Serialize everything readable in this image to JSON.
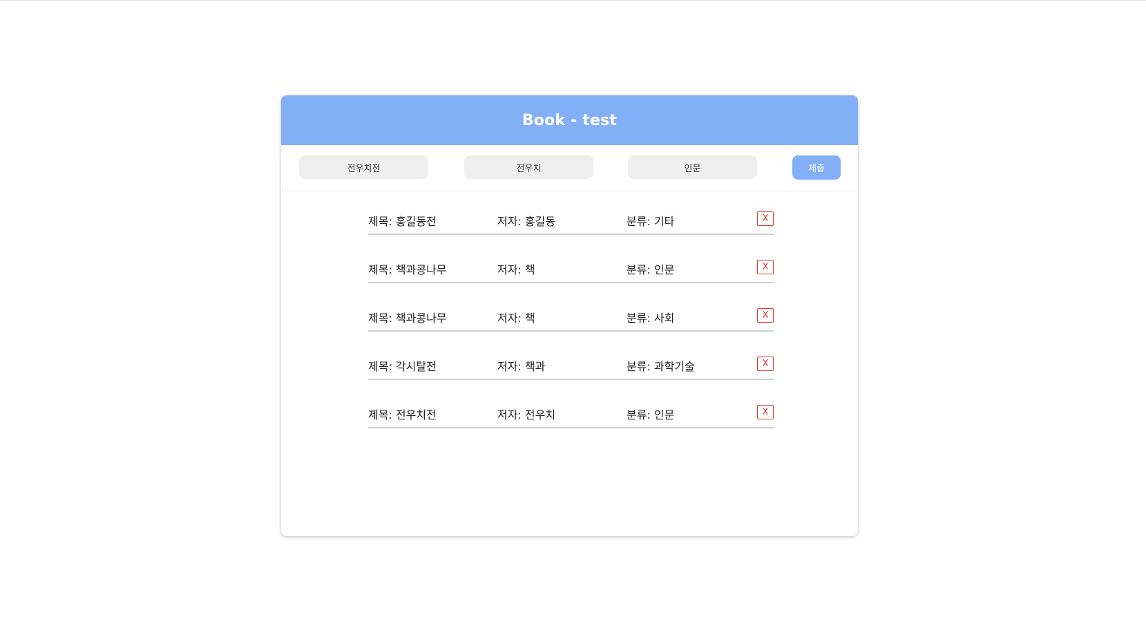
{
  "app": {
    "title": "Book - test"
  },
  "form": {
    "title_value": "전우치전",
    "author_value": "전우치",
    "category_value": "인문",
    "submit_label": "제출"
  },
  "books": [
    {
      "title": "제목: 홍길동전",
      "author": "저자: 홍길동",
      "category": "분류: 기타",
      "delete_label": "X"
    },
    {
      "title": "제목: 책과콩나무",
      "author": "저자: 책",
      "category": "분류: 인문",
      "delete_label": "X"
    },
    {
      "title": "제목: 책과콩나무",
      "author": "저자: 책",
      "category": "분류: 사회",
      "delete_label": "X"
    },
    {
      "title": "제목: 각시탈전",
      "author": "저자: 책과",
      "category": "분류: 과학기술",
      "delete_label": "X"
    },
    {
      "title": "제목: 전우치전",
      "author": "저자: 전우치",
      "category": "분류: 인문",
      "delete_label": "X"
    }
  ],
  "colors": {
    "header_bg": "#82aff5",
    "delete_red": "#e53935"
  }
}
